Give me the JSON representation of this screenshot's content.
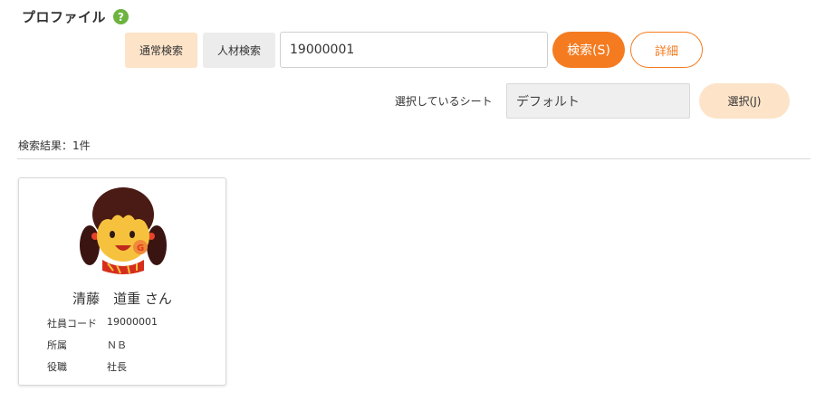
{
  "page": {
    "title": "プロファイル",
    "help_icon": "question-circle-icon"
  },
  "search": {
    "tab_normal": "通常検索",
    "tab_talent": "人材検索",
    "value": "19000001",
    "search_button": "検索(S)",
    "detail_button": "詳細"
  },
  "sheet": {
    "label": "選択しているシート",
    "value": "デフォルト",
    "select_button": "選択(J)"
  },
  "results": {
    "count_text": "検索結果：1件",
    "cards": [
      {
        "name": "清藤　道重",
        "honorific": "さん",
        "avatar_icon": "user-avatar-icon",
        "fields": [
          {
            "label": "社員コード",
            "value": "19000001"
          },
          {
            "label": "所属",
            "value": "ＮＢ"
          },
          {
            "label": "役職",
            "value": "社長"
          }
        ]
      }
    ]
  },
  "colors": {
    "accent": "#f47b20",
    "accent_light": "#fde3c8",
    "help_green": "#6db33f"
  }
}
